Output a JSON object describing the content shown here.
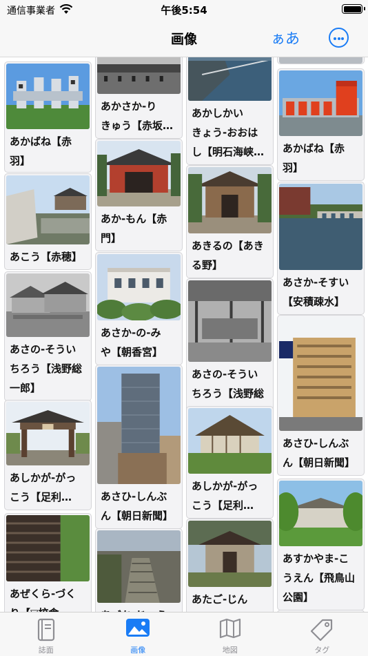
{
  "status": {
    "carrier": "通信事業者",
    "time": "午後5:54"
  },
  "nav": {
    "title": "画像",
    "kana_button": "ぁあ",
    "more_icon": "ellipsis-circle-icon"
  },
  "colors": {
    "accent": "#1a7cf5",
    "inactive": "#8e8e93"
  },
  "cards": {
    "col1": [
      {
        "caption": "あかばね【赤\n羽】",
        "scene": "water-gate"
      },
      {
        "caption": "あこう【赤穂】",
        "scene": "castle-stone"
      },
      {
        "caption": "あさの-そうい\nちろう【浅野総\n一郎】",
        "scene": "bw-mansion"
      },
      {
        "caption": "あしかが-がっ\nこう【足利…",
        "scene": "gate"
      },
      {
        "caption": "あぜくら-づく\nり【▽校倉…",
        "scene": "log-wall"
      }
    ],
    "col2": [
      {
        "caption": "あかさか-り\nきゅう【赤坂…",
        "scene": "bw-palace"
      },
      {
        "caption": "あか-もん【赤\n門】",
        "scene": "red-gate"
      },
      {
        "caption": "あさか-の-み\nや【朝香宮】",
        "scene": "white-villa"
      },
      {
        "caption": "あさひ-しんぶ\nん【朝日新聞】",
        "scene": "tower"
      },
      {
        "caption": "あづち-じょう",
        "scene": "stone-steps"
      }
    ],
    "col3": [
      {
        "caption": "あかしかい\nきょう-おおは\nし【明石海峡…",
        "scene": "bridge-aerial"
      },
      {
        "caption": "あきるの【あき\nる野】",
        "scene": "temple-gate"
      },
      {
        "caption": "あさの-そうい\nちろう【浅野総\n一郎】",
        "scene": "bw-interior"
      },
      {
        "caption": "あしかが-がっ\nこう【足利…",
        "scene": "thatched-hall"
      },
      {
        "caption": "あたご-じん\nじゃ【愛宕…",
        "scene": "shrine"
      }
    ],
    "col4": [
      {
        "caption": "",
        "scene": "blank"
      },
      {
        "caption": "あかばね【赤\n羽】",
        "scene": "red-sluice"
      },
      {
        "caption": "あさか-そすい\n【安積疎水】",
        "scene": "river-dam"
      },
      {
        "caption": "あさひ-しんぶ\nん【朝日新聞】",
        "scene": "office-building"
      },
      {
        "caption": "あすかやま-こ\nうえん【飛鳥山\n公園】",
        "scene": "park-building"
      },
      {
        "caption": "",
        "scene": "blank"
      }
    ]
  },
  "tabs": [
    {
      "label": "誌面",
      "icon": "book-icon",
      "active": false
    },
    {
      "label": "画像",
      "icon": "photo-icon",
      "active": true
    },
    {
      "label": "地図",
      "icon": "map-icon",
      "active": false
    },
    {
      "label": "タグ",
      "icon": "tag-icon",
      "active": false
    }
  ]
}
